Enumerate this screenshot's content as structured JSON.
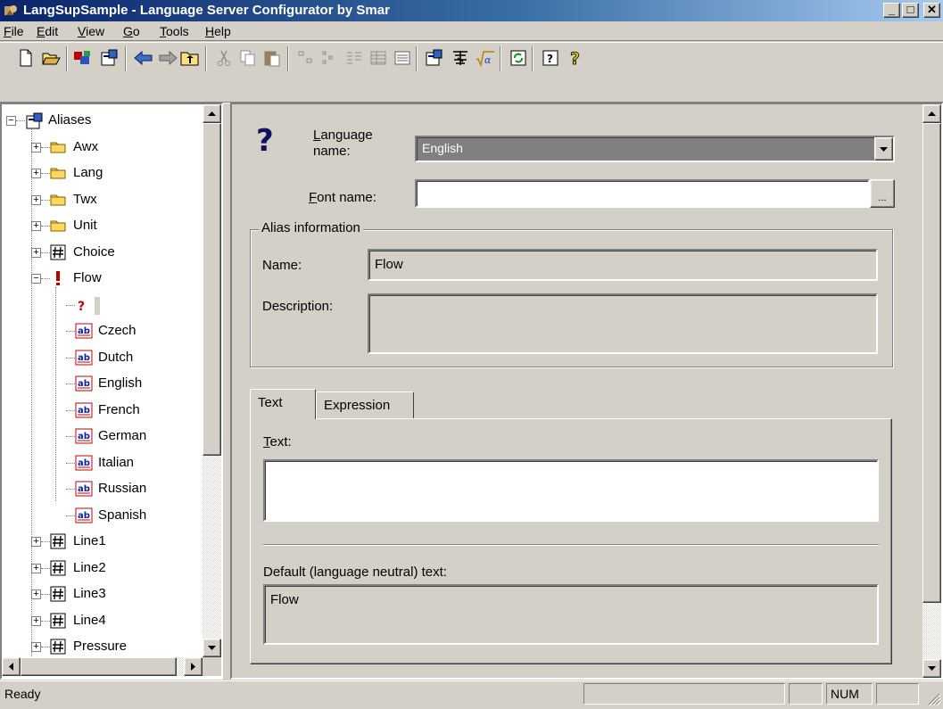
{
  "window": {
    "title": "LangSupSample - Language Server Configurator by Smar"
  },
  "menu": [
    "File",
    "Edit",
    "View",
    "Go",
    "Tools",
    "Help"
  ],
  "toolbar_icons": [
    "new-icon",
    "open-icon",
    "config-icon",
    "properties-icon",
    "back-icon",
    "forward-icon",
    "up-folder-icon",
    "cut-icon",
    "copy-icon",
    "paste-icon",
    "large-icons-icon",
    "small-icons-icon",
    "list-icon",
    "details-icon",
    "view-icon",
    "properties-page-icon",
    "chinese-char-icon",
    "formula-icon",
    "refresh-icon",
    "about-icon",
    "help-icon"
  ],
  "tree": {
    "root": "Aliases",
    "items": [
      "Awx",
      "Lang",
      "Twx",
      "Unit",
      "Choice",
      "Flow"
    ],
    "flow_children": [
      "Czech",
      "Dutch",
      "English",
      "French",
      "German",
      "Italian",
      "Russian",
      "Spanish"
    ],
    "after": [
      "Line1",
      "Line2",
      "Line3",
      "Line4",
      "Pressure"
    ]
  },
  "form": {
    "language_label": "Language name:",
    "language_label_line1": "Language",
    "language_label_line2": "name:",
    "language_value": "English",
    "font_label": "Font name:",
    "font_value": "",
    "browse_label": "...",
    "alias_group": "Alias information",
    "name_label": "Name:",
    "name_value": "Flow",
    "description_label": "Description:",
    "description_value": "",
    "tabs": [
      "Text",
      "Expression"
    ],
    "text_label": "Text:",
    "text_value": "",
    "default_label": "Default (language neutral) text:",
    "default_value": "Flow"
  },
  "status": {
    "message": "Ready",
    "num": "NUM"
  }
}
